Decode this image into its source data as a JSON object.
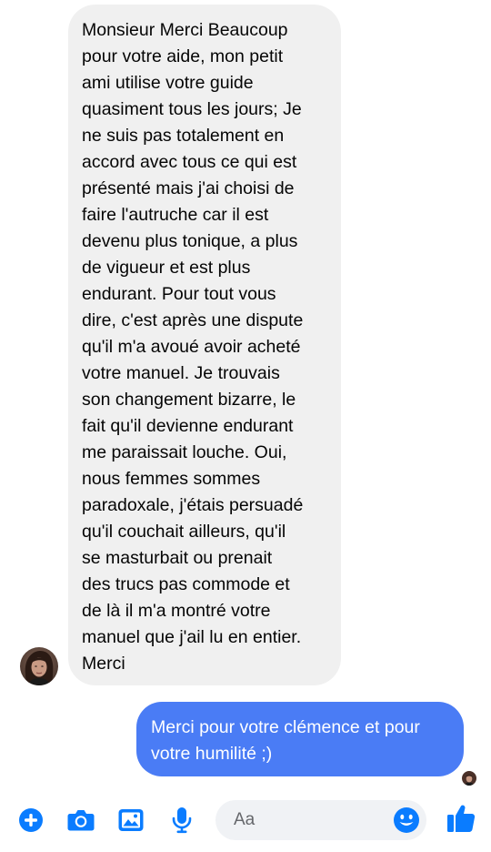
{
  "conversation": {
    "incoming_message": "Monsieur Merci Beaucoup\npour votre aide, mon petit\nami utilise votre guide\nquasiment tous les jours; Je\nne suis pas totalement en\naccord avec tous ce qui est\nprésenté mais j'ai choisi de\nfaire l'autruche car il est\ndevenu plus tonique, a plus\nde vigueur et est plus\nendurant. Pour tout vous\ndire, c'est après une dispute\nqu'il m'a avoué avoir acheté\nvotre manuel. Je trouvais\nson changement bizarre, le\nfait qu'il devienne endurant\nme paraissait louche. Oui,\nnous femmes sommes\nparadoxale, j'étais persuadé\nqu'il couchait ailleurs, qu'il\nse masturbait ou prenait\ndes trucs pas commode et\nde là il m'a montré votre\nmanuel que j'ail lu en entier.\nMerci",
    "outgoing_message": "Merci pour votre clémence et pour\nvotre humilité ;)"
  },
  "composer": {
    "placeholder": "Aa",
    "icons": [
      "plus-circle-icon",
      "camera-icon",
      "image-icon",
      "microphone-icon",
      "emoji-icon",
      "thumbs-up-icon"
    ]
  },
  "colors": {
    "accent": "#0a7cff",
    "outgoing_bubble": "#4a7cf5",
    "incoming_bubble": "#f0f0f0",
    "input_background": "#f0f2f5",
    "emoji_yellow": "#0a7cff"
  }
}
